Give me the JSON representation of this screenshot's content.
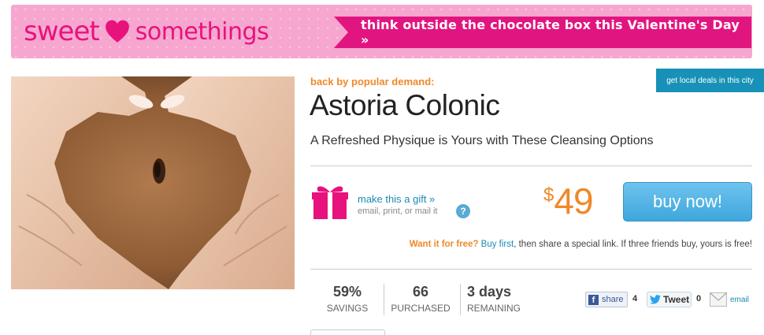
{
  "banner": {
    "logo_word1": "sweet",
    "logo_word2": "somethings",
    "tagline": "think outside the chocolate box this Valentine's Day »",
    "colors": {
      "background": "#f6a6cf",
      "accent": "#e1157f"
    }
  },
  "photo": {
    "subject": "hands forming a heart around a navel"
  },
  "local_deals": {
    "label": "get local deals in this city"
  },
  "deal": {
    "kicker": "back by popular demand:",
    "title": "Astoria Colonic",
    "subtitle": "A Refreshed Physique is Yours with These Cleansing Options"
  },
  "gift": {
    "link": "make this a gift »",
    "sub": "email, print, or mail it",
    "help": "?"
  },
  "price": {
    "symbol": "$",
    "value": "49"
  },
  "buy": {
    "label": "buy now!"
  },
  "free_offer": {
    "question": "Want it for free?",
    "link": "Buy first",
    "rest": ", then share a special link. If three friends buy, yours is free!"
  },
  "stats": [
    {
      "value": "59%",
      "label": "SAVINGS"
    },
    {
      "value": "66",
      "label": "PURCHASED"
    },
    {
      "value": "3 days",
      "label": "REMAINING"
    }
  ],
  "social": {
    "fb_label": "share",
    "fb_count": "4",
    "tw_label": "Tweet",
    "tw_count": "0",
    "email_label": "email"
  },
  "colors": {
    "orange": "#f0882a",
    "link": "#1b8ab5",
    "button": "#3ea6dc"
  }
}
